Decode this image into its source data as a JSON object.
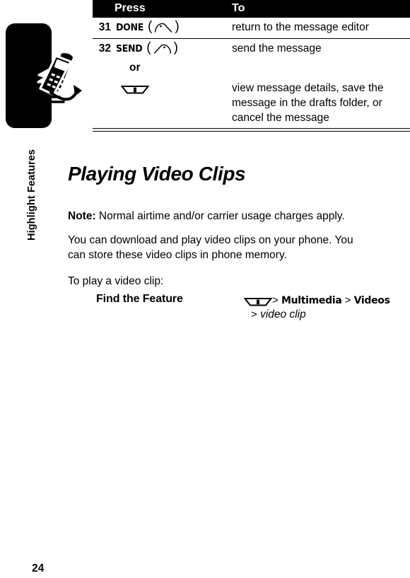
{
  "sidebar": {
    "label": "Highlight Features",
    "icon": "flying-phone-icon"
  },
  "table": {
    "headers": {
      "press": "Press",
      "to": "To"
    },
    "rows": [
      {
        "num": "31",
        "key_label": "DONE",
        "key_icon": "left-soft-key-icon",
        "to": "return to the message editor"
      },
      {
        "num": "32",
        "key_label": "SEND",
        "key_icon": "right-soft-key-icon",
        "to": "send the message"
      }
    ],
    "or_label": "or",
    "alt_row": {
      "key_icon": "menu-key-icon",
      "to": "view message details, save the message in the drafts folder, or cancel the message"
    }
  },
  "section": {
    "title": "Playing Video Clips",
    "note_label": "Note:",
    "note_text": "Normal airtime and/or carrier usage charges apply.",
    "body": "You can download and play video clips on your phone. You can store these video clips in phone memory.",
    "intro": "To play a video clip:"
  },
  "find_feature": {
    "label": "Find the Feature",
    "menu_icon": "menu-key-icon",
    "sep": ">",
    "path": [
      "Multimedia",
      "Videos"
    ],
    "path_variable": "video clip"
  },
  "footer": {
    "page_number": "24"
  },
  "colors": {
    "ink": "#000000",
    "paper": "#ffffff",
    "header_bar": "#000000",
    "header_text": "#ffffff"
  }
}
